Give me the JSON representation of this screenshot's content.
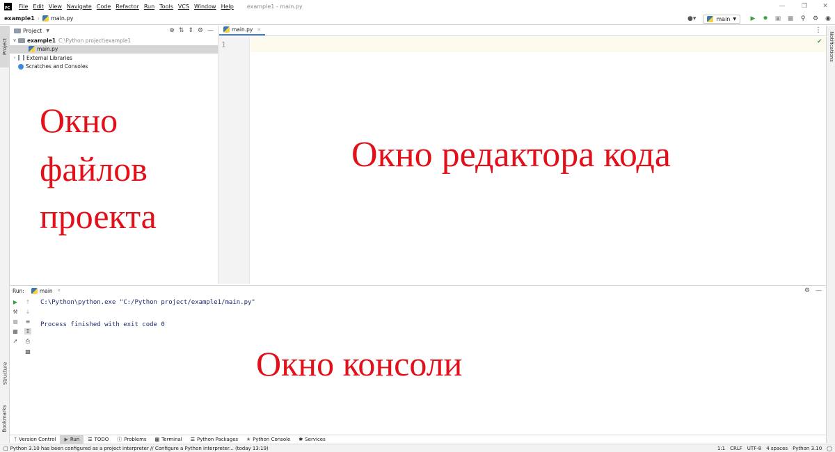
{
  "menubar": {
    "items": [
      "File",
      "Edit",
      "View",
      "Navigate",
      "Code",
      "Refactor",
      "Run",
      "Tools",
      "VCS",
      "Window",
      "Help"
    ],
    "window_title": "example1 - main.py"
  },
  "navbar": {
    "project": "example1",
    "file": "main.py",
    "run_config": "main"
  },
  "left_stripe": {
    "project": "Project",
    "structure": "Structure",
    "bookmarks": "Bookmarks"
  },
  "right_stripe": {
    "notifications": "Notifications"
  },
  "project_panel": {
    "title": "Project",
    "tree": {
      "root_name": "example1",
      "root_path": "C:\\Python project\\example1",
      "file": "main.py",
      "external": "External Libraries",
      "scratches": "Scratches and Consoles"
    }
  },
  "overlays": {
    "project_line1": "Окно",
    "project_line2": "файлов",
    "project_line3": "проекта",
    "editor": "Окно редактора кода",
    "console": "Окно консоли"
  },
  "editor": {
    "tab": "main.py",
    "line_numbers": [
      "1"
    ]
  },
  "run_panel": {
    "label": "Run:",
    "tab": "main",
    "lines": [
      "C:\\Python\\python.exe \"C:/Python project/example1/main.py\"",
      "Process finished with exit code 0"
    ]
  },
  "bottom_tools": [
    "Version Control",
    "Run",
    "TODO",
    "Problems",
    "Terminal",
    "Python Packages",
    "Python Console",
    "Services"
  ],
  "status": {
    "message": "Python 3.10 has been configured as a project interpreter // Configure a Python interpreter... (today 13:19)",
    "position": "1:1",
    "line_sep": "CRLF",
    "encoding": "UTF-8",
    "indent": "4 spaces",
    "interpreter": "Python 3.10"
  }
}
